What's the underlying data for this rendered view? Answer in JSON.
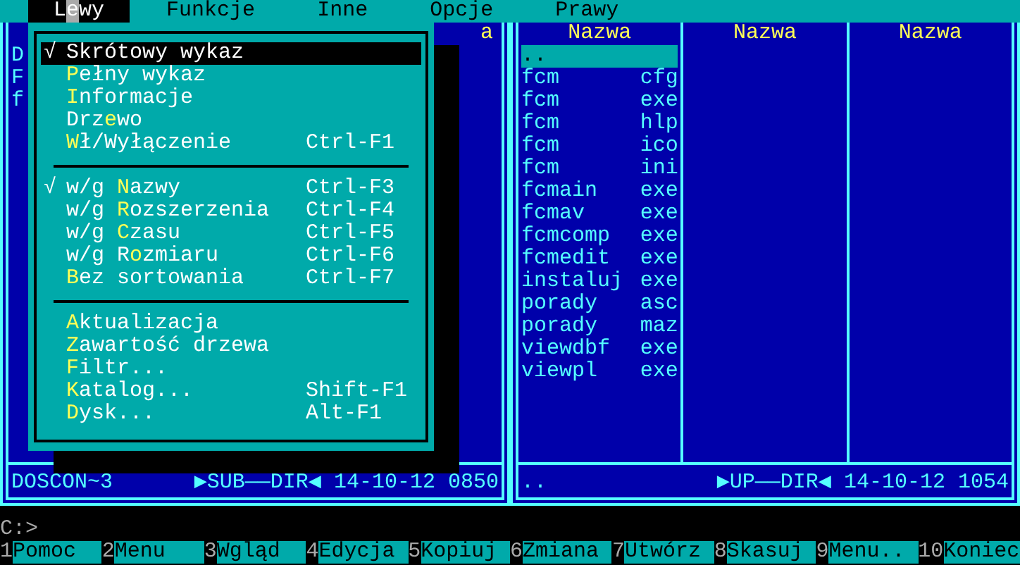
{
  "menu_bar": [
    {
      "parts": [
        {
          "text": "L",
          "hot": false
        },
        {
          "text": "e",
          "hot": true
        },
        {
          "text": "wy",
          "hot": false
        }
      ],
      "selected": true
    },
    {
      "parts": [
        {
          "text": "Funkcje",
          "hot": false
        }
      ],
      "selected": false
    },
    {
      "parts": [
        {
          "text": "Inne",
          "hot": false
        }
      ],
      "selected": false
    },
    {
      "parts": [
        {
          "text": "Opcje",
          "hot": false
        }
      ],
      "selected": false
    },
    {
      "parts": [
        {
          "text": "Prawy",
          "hot": false
        }
      ],
      "selected": false
    }
  ],
  "left_panel": {
    "columns": [
      {
        "files": [
          {
            "name": "D",
            "selected": false
          },
          {
            "name": "F",
            "selected": false
          },
          {
            "name": "f",
            "selected": false
          }
        ]
      },
      {},
      {
        "header": "a"
      }
    ],
    "status": {
      "name": "DOSCON~3",
      "type": "▶SUB——DIR◀",
      "date": "14-10-12",
      "time": "0850"
    }
  },
  "right_panel": {
    "columns": [
      {
        "header": "Nazwa",
        "files": [
          {
            "name": "..",
            "selected": true
          },
          {
            "name": "fcm",
            "ext": "cfg",
            "selected": false
          },
          {
            "name": "fcm",
            "ext": "exe",
            "selected": false
          },
          {
            "name": "fcm",
            "ext": "hlp",
            "selected": false
          },
          {
            "name": "fcm",
            "ext": "ico",
            "selected": false
          },
          {
            "name": "fcm",
            "ext": "ini",
            "selected": false
          },
          {
            "name": "fcmain",
            "ext": "exe",
            "selected": false
          },
          {
            "name": "fcmav",
            "ext": "exe",
            "selected": false
          },
          {
            "name": "fcmcomp",
            "ext": "exe",
            "selected": false
          },
          {
            "name": "fcmedit",
            "ext": "exe",
            "selected": false
          },
          {
            "name": "instaluj",
            "ext": "exe",
            "selected": false
          },
          {
            "name": "porady",
            "ext": "asc",
            "selected": false
          },
          {
            "name": "porady",
            "ext": "maz",
            "selected": false
          },
          {
            "name": "viewdbf",
            "ext": "exe",
            "selected": false
          },
          {
            "name": "viewpl",
            "ext": "exe",
            "selected": false
          }
        ]
      },
      {
        "header": "Nazwa"
      },
      {
        "header": "Nazwa"
      }
    ],
    "status": {
      "name": "..",
      "type": "▶UP——DIR◀",
      "date": "14-10-12",
      "time": "1054"
    }
  },
  "dropdown": [
    {
      "kind": "item",
      "checked": true,
      "selected": true,
      "parts": [
        {
          "text": "Skrótowy wykaz"
        }
      ]
    },
    {
      "kind": "item",
      "checked": false,
      "selected": false,
      "parts": [
        {
          "text": "P",
          "hot": true
        },
        {
          "text": "ełny wykaz",
          "hot": false
        }
      ]
    },
    {
      "kind": "item",
      "checked": false,
      "selected": false,
      "parts": [
        {
          "text": "I",
          "hot": true
        },
        {
          "text": "nformacje",
          "hot": false
        }
      ]
    },
    {
      "kind": "item",
      "checked": false,
      "selected": false,
      "parts": [
        {
          "text": "Drz",
          "hot": false
        },
        {
          "text": "e",
          "hot": true
        },
        {
          "text": "wo",
          "hot": false
        }
      ]
    },
    {
      "kind": "item",
      "checked": false,
      "selected": false,
      "parts": [
        {
          "text": "W",
          "hot": true
        },
        {
          "text": "ł/Wyłączenie",
          "hot": false
        }
      ],
      "shortcut": "Ctrl-F1"
    },
    {
      "kind": "separator"
    },
    {
      "kind": "item",
      "checked": true,
      "selected": false,
      "parts": [
        {
          "text": "w/g ",
          "hot": false
        },
        {
          "text": "N",
          "hot": true
        },
        {
          "text": "azwy",
          "hot": false
        }
      ],
      "shortcut": "Ctrl-F3"
    },
    {
      "kind": "item",
      "checked": false,
      "selected": false,
      "parts": [
        {
          "text": "w/g ",
          "hot": false
        },
        {
          "text": "R",
          "hot": true
        },
        {
          "text": "ozszerzenia",
          "hot": false
        }
      ],
      "shortcut": "Ctrl-F4"
    },
    {
      "kind": "item",
      "checked": false,
      "selected": false,
      "parts": [
        {
          "text": "w/g ",
          "hot": false
        },
        {
          "text": "C",
          "hot": true
        },
        {
          "text": "zasu",
          "hot": false
        }
      ],
      "shortcut": "Ctrl-F5"
    },
    {
      "kind": "item",
      "checked": false,
      "selected": false,
      "parts": [
        {
          "text": "w/g R",
          "hot": false
        },
        {
          "text": "o",
          "hot": true
        },
        {
          "text": "zmiaru",
          "hot": false
        }
      ],
      "shortcut": "Ctrl-F6"
    },
    {
      "kind": "item",
      "checked": false,
      "selected": false,
      "parts": [
        {
          "text": "B",
          "hot": true
        },
        {
          "text": "ez sortowania",
          "hot": false
        }
      ],
      "shortcut": "Ctrl-F7"
    },
    {
      "kind": "separator"
    },
    {
      "kind": "item",
      "checked": false,
      "selected": false,
      "parts": [
        {
          "text": "A",
          "hot": true
        },
        {
          "text": "ktualizacja",
          "hot": false
        }
      ]
    },
    {
      "kind": "item",
      "checked": false,
      "selected": false,
      "parts": [
        {
          "text": "Z",
          "hot": true
        },
        {
          "text": "awartość drzewa",
          "hot": false
        }
      ]
    },
    {
      "kind": "item",
      "checked": false,
      "selected": false,
      "parts": [
        {
          "text": "F",
          "hot": true
        },
        {
          "text": "iltr...",
          "hot": false
        }
      ]
    },
    {
      "kind": "item",
      "checked": false,
      "selected": false,
      "parts": [
        {
          "text": "K",
          "hot": true
        },
        {
          "text": "atalog...",
          "hot": false
        }
      ],
      "shortcut": "Shift-F1"
    },
    {
      "kind": "item",
      "checked": false,
      "selected": false,
      "parts": [
        {
          "text": "D",
          "hot": true
        },
        {
          "text": "ysk...",
          "hot": false
        }
      ],
      "shortcut": "Alt-F1"
    }
  ],
  "check_mark": "√",
  "command_line": "C:>",
  "function_keys": [
    {
      "key": "1",
      "label": "Pomoc"
    },
    {
      "key": "2",
      "label": "Menu"
    },
    {
      "key": "3",
      "label": "Wgląd"
    },
    {
      "key": "4",
      "label": "Edycja"
    },
    {
      "key": "5",
      "label": "Kopiuj"
    },
    {
      "key": "6",
      "label": "Zmiana"
    },
    {
      "key": "7",
      "label": "Utwórz"
    },
    {
      "key": "8",
      "label": "Skasuj"
    },
    {
      "key": "9",
      "label": "Menu.."
    },
    {
      "key": "10",
      "label": "Koniec"
    }
  ]
}
